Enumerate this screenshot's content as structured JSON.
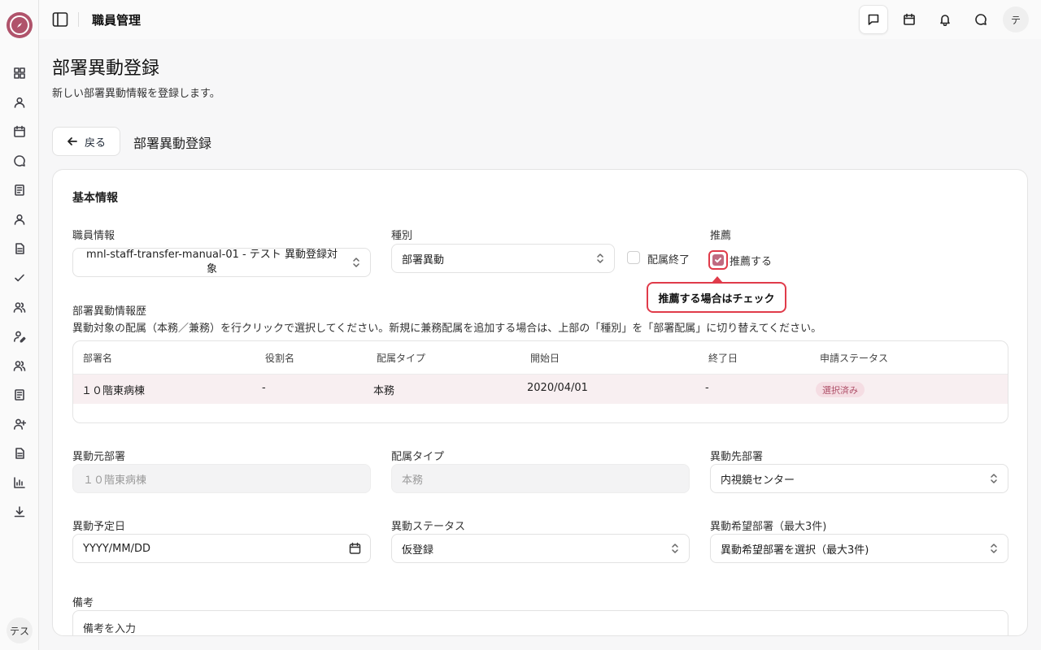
{
  "sidebar": {
    "items": [
      {
        "icon": "dashboard-icon"
      },
      {
        "icon": "user-icon"
      },
      {
        "icon": "calendar-icon"
      },
      {
        "icon": "chat-icon"
      },
      {
        "icon": "book-icon"
      },
      {
        "icon": "person-icon"
      },
      {
        "icon": "document-icon"
      },
      {
        "icon": "check-icon"
      },
      {
        "icon": "users-icon"
      },
      {
        "icon": "user-edit-icon"
      },
      {
        "icon": "group-icon"
      },
      {
        "icon": "notebook-icon"
      },
      {
        "icon": "user-plus-icon"
      },
      {
        "icon": "file-text-icon"
      },
      {
        "icon": "bar-chart-icon"
      },
      {
        "icon": "download-icon"
      }
    ],
    "avatar": "テス"
  },
  "header": {
    "title": "職員管理",
    "avatar": "テ"
  },
  "page": {
    "title": "部署異動登録",
    "subtitle": "新しい部署異動情報を登録します。",
    "back_label": "戻る",
    "section_title": "部署異動登録"
  },
  "form": {
    "heading": "基本情報",
    "staff_label": "職員情報",
    "staff_value": "mnl-staff-transfer-manual-01 - テスト 異動登録対象",
    "type_label": "種別",
    "type_value": "部署異動",
    "end_label": "配属終了",
    "recommend_label": "推薦",
    "recommend_checkbox_label": "推薦する",
    "recommend_checked": true,
    "tooltip": "推薦する場合はチェック",
    "history_label": "部署異動情報歴",
    "history_hint": "異動対象の配属（本務／兼務）を行クリックで選択してください。新規に兼務配属を追加する場合は、上部の「種別」を「部署配属」に切り替えてください。",
    "table": {
      "headers": [
        "部署名",
        "役割名",
        "配属タイプ",
        "開始日",
        "終了日",
        "申請ステータス"
      ],
      "rows": [
        {
          "dept": "１０階東病棟",
          "role": "-",
          "assign_type": "本務",
          "start": "2020/04/01",
          "end": "-",
          "status": "選択済み"
        }
      ]
    },
    "from_dept_label": "異動元部署",
    "from_dept_value": "１０階東病棟",
    "assign_type_label": "配属タイプ",
    "assign_type_value": "本務",
    "to_dept_label": "異動先部署",
    "to_dept_value": "内視鏡センター",
    "date_label": "異動予定日",
    "date_placeholder": "YYYY/MM/DD",
    "status_label": "異動ステータス",
    "status_value": "仮登録",
    "wish_label": "異動希望部署（最大3件)",
    "wish_placeholder": "異動希望部署を選択（最大3件)",
    "notes_label": "備考",
    "notes_placeholder": "備考を入力"
  },
  "colors": {
    "accent": "#b0536b",
    "highlight": "#e03b4a",
    "selected_row": "#f8eff1"
  }
}
